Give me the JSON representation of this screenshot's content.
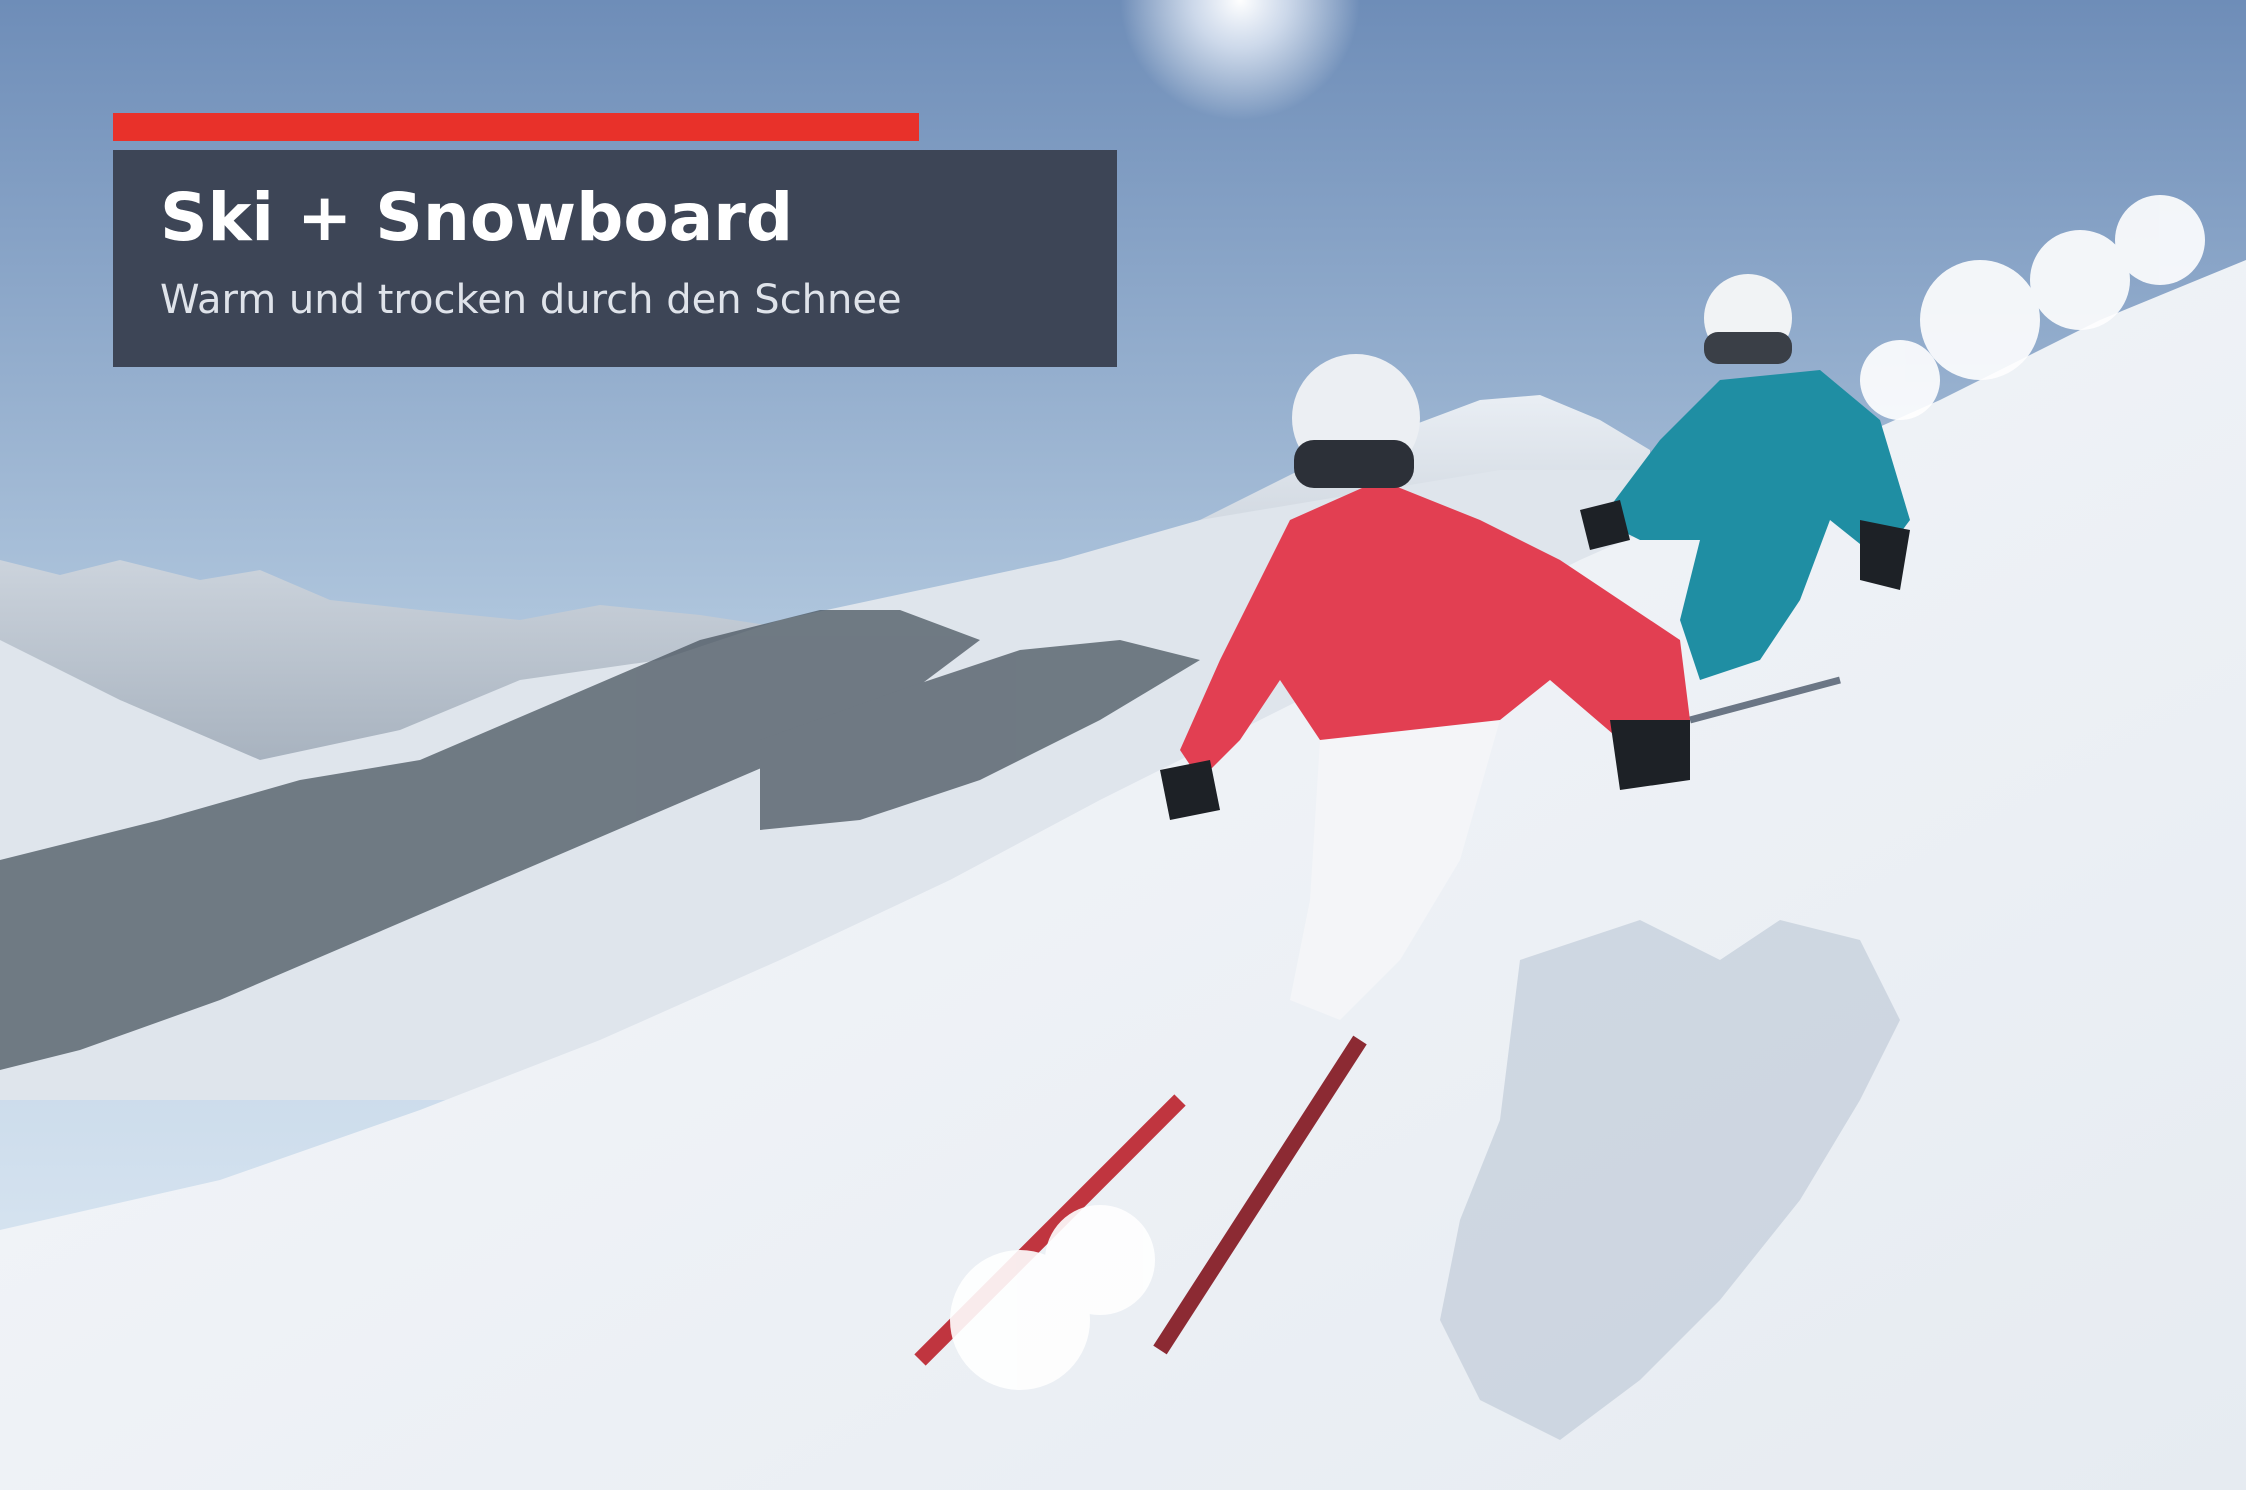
{
  "banner": {
    "title": "Ski + Snowboard",
    "subtitle": "Warm und trocken durch den Schnee"
  },
  "colors": {
    "accent": "#e8312a",
    "banner_bg": "#3d4556",
    "title_text": "#ffffff",
    "subtitle_text": "#dfe3ea"
  },
  "photo": {
    "icon": "skiers-on-mountain-photo"
  }
}
